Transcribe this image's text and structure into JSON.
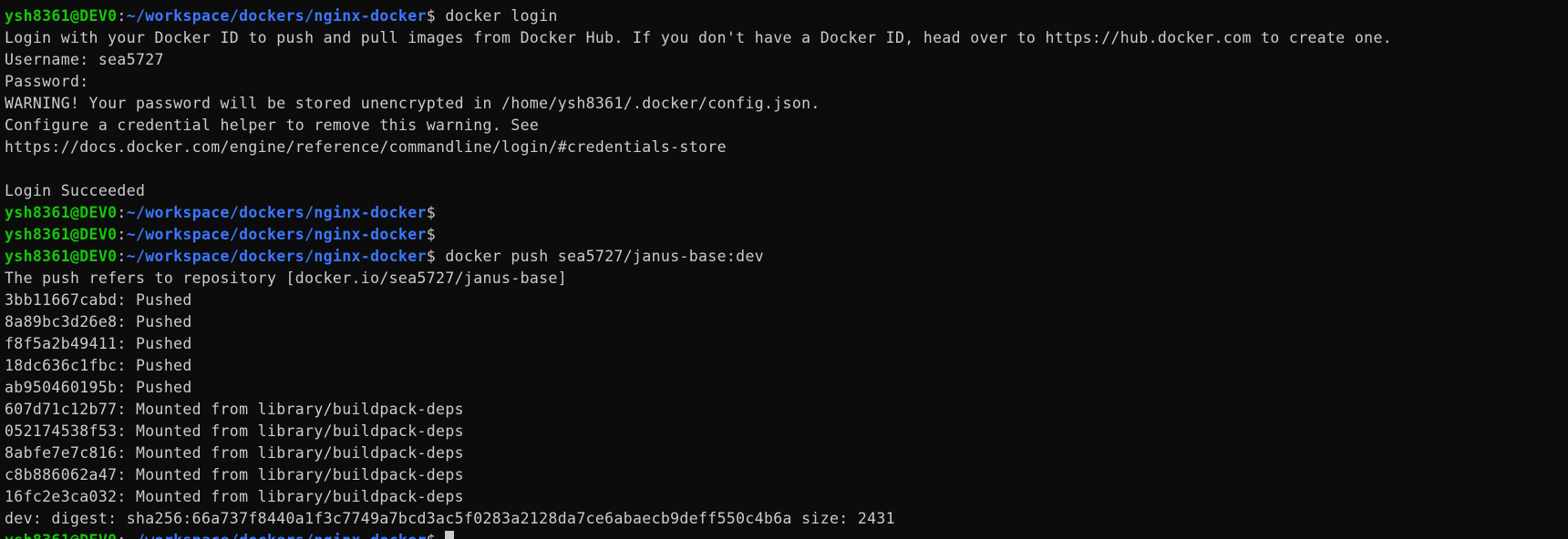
{
  "terminal": {
    "prompt": {
      "user_host": "ysh8361@DEV0",
      "separator": ":",
      "path": "~/workspace/dockers/nginx-docker",
      "symbol": "$"
    },
    "lines": [
      {
        "type": "prompt",
        "cmd": " docker login"
      },
      {
        "type": "out",
        "text": "Login with your Docker ID to push and pull images from Docker Hub. If you don't have a Docker ID, head over to https://hub.docker.com to create one."
      },
      {
        "type": "out",
        "text": "Username: sea5727"
      },
      {
        "type": "out",
        "text": "Password:"
      },
      {
        "type": "out",
        "text": "WARNING! Your password will be stored unencrypted in /home/ysh8361/.docker/config.json."
      },
      {
        "type": "out",
        "text": "Configure a credential helper to remove this warning. See"
      },
      {
        "type": "out",
        "text": "https://docs.docker.com/engine/reference/commandline/login/#credentials-store"
      },
      {
        "type": "out",
        "text": ""
      },
      {
        "type": "out",
        "text": "Login Succeeded"
      },
      {
        "type": "prompt",
        "cmd": ""
      },
      {
        "type": "prompt",
        "cmd": ""
      },
      {
        "type": "prompt",
        "cmd": " docker push sea5727/janus-base:dev"
      },
      {
        "type": "out",
        "text": "The push refers to repository [docker.io/sea5727/janus-base]"
      },
      {
        "type": "out",
        "text": "3bb11667cabd: Pushed"
      },
      {
        "type": "out",
        "text": "8a89bc3d26e8: Pushed"
      },
      {
        "type": "out",
        "text": "f8f5a2b49411: Pushed"
      },
      {
        "type": "out",
        "text": "18dc636c1fbc: Pushed"
      },
      {
        "type": "out",
        "text": "ab950460195b: Pushed"
      },
      {
        "type": "out",
        "text": "607d71c12b77: Mounted from library/buildpack-deps"
      },
      {
        "type": "out",
        "text": "052174538f53: Mounted from library/buildpack-deps"
      },
      {
        "type": "out",
        "text": "8abfe7e7c816: Mounted from library/buildpack-deps"
      },
      {
        "type": "out",
        "text": "c8b886062a47: Mounted from library/buildpack-deps"
      },
      {
        "type": "out",
        "text": "16fc2e3ca032: Mounted from library/buildpack-deps"
      },
      {
        "type": "out",
        "text": "dev: digest: sha256:66a737f8440a1f3c7749a7bcd3ac5f0283a2128da7ce6abaecb9deff550c4b6a size: 2431"
      },
      {
        "type": "prompt",
        "cmd": " ",
        "cursor": true
      }
    ]
  }
}
